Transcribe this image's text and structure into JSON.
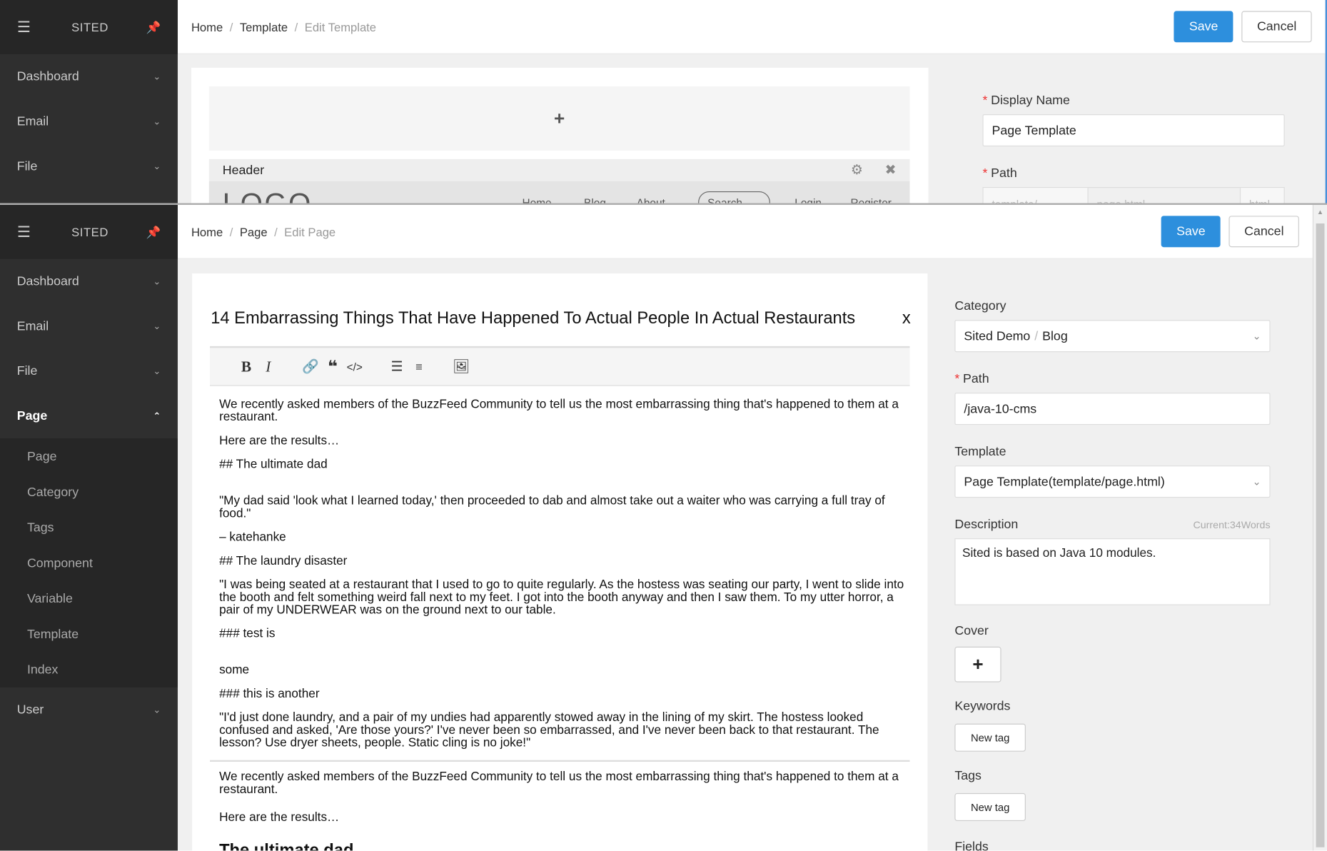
{
  "top_window": {
    "brand": "SITED",
    "nav": [
      "Dashboard",
      "Email",
      "File"
    ],
    "breadcrumb": [
      "Home",
      "Template",
      "Edit Template"
    ],
    "save": "Save",
    "cancel": "Cancel",
    "add_symbol": "+",
    "header_block": "Header",
    "logo_text": "LOGO",
    "menu_items": [
      "Home",
      "Blog",
      "About",
      "Search",
      "Login",
      "Register"
    ],
    "display_name_label": "Display Name",
    "display_name_value": "Page Template",
    "path_label": "Path",
    "path_prefix": "template/",
    "path_placeholder": "page.html",
    "path_suffix": "html"
  },
  "bottom_window": {
    "brand": "SITED",
    "nav": [
      "Dashboard",
      "Email",
      "File"
    ],
    "page_nav": "Page",
    "page_subnav": [
      "Page",
      "Category",
      "Tags",
      "Component",
      "Variable",
      "Template",
      "Index"
    ],
    "user_nav": "User",
    "breadcrumb": [
      "Home",
      "Page",
      "Edit Page"
    ],
    "save": "Save",
    "cancel": "Cancel",
    "title": "14 Embarrassing Things That Have Happened To Actual People In Actual Restaurants",
    "close": "x",
    "markdown": [
      "We recently asked members of the BuzzFeed Community to tell us the most embarrassing thing that's happened to them at a restaurant.",
      "Here are the results…",
      "## The ultimate dad",
      "\"My dad said 'look what I learned today,' then proceeded to dab and almost take out a waiter who was carrying a full tray of food.\"",
      "– katehanke",
      "## The laundry disaster",
      "\"I was being seated at a restaurant that I used to go to quite regularly. As the hostess was seating our party, I went to slide into the booth and felt something weird fall next to my feet. I got into the booth anyway and then I saw them. To my utter horror, a pair of my UNDERWEAR was on the ground next to our table.",
      "### test is",
      "some",
      "### this is another",
      "\"I'd just done laundry, and a pair of my undies had apparently stowed away in the lining of my skirt. The hostess looked confused and asked, 'Are those yours?' I've never been so embarrassed, and I've never been back to that restaurant. The lesson? Use dryer sheets, people. Static cling is no joke!\""
    ],
    "preview": [
      "We recently asked members of the BuzzFeed Community to tell us the most embarrassing thing that's happened to them at a restaurant.",
      "Here are the results…",
      "The ultimate dad"
    ],
    "category_label": "Category",
    "category_value_a": "Sited Demo",
    "category_sep": "/",
    "category_value_b": "Blog",
    "path_label": "Path",
    "path_value": "/java-10-cms",
    "template_label": "Template",
    "template_value": "Page Template(template/page.html)",
    "description_label": "Description",
    "description_count": "Current:34Words",
    "description_value": "Sited is based on Java 10 modules.",
    "cover_label": "Cover",
    "cover_add": "+",
    "keywords_label": "Keywords",
    "new_tag": "New tag",
    "tags_label": "Tags",
    "fields_label": "Fields"
  },
  "colors": {
    "primary": "#2d8fdd",
    "sidebar": "#2f2f2f",
    "required": "#e33333"
  }
}
